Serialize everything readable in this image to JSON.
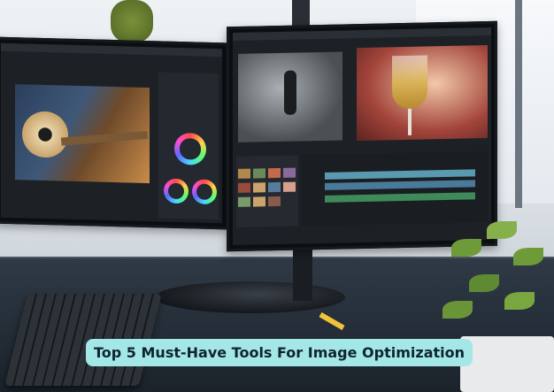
{
  "banner": {
    "title": "Top 5 Must-Have Tools For Image Optimization",
    "background_color": "#a4e7e7",
    "text_color": "#0f2430"
  },
  "scene": {
    "subjects": [
      "dual-monitor",
      "video-editing-software",
      "keyboard",
      "potted-plant"
    ]
  }
}
